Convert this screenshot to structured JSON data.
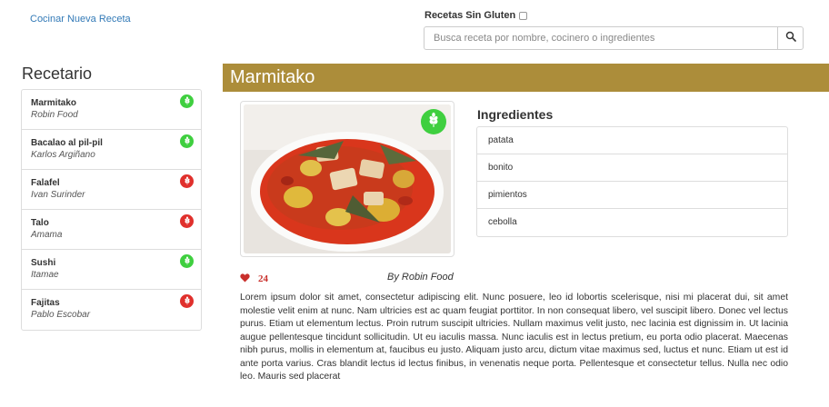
{
  "header": {
    "new_recipe_link": "Cocinar Nueva Receta",
    "gluten_filter_label": "Recetas Sin Gluten",
    "search_placeholder": "Busca receta por nombre, cocinero o ingredientes"
  },
  "sidebar": {
    "title": "Recetario",
    "items": [
      {
        "name": "Marmitako",
        "cook": "Robin Food",
        "gluten_free": true
      },
      {
        "name": "Bacalao al pil-pil",
        "cook": "Karlos Argiñano",
        "gluten_free": true
      },
      {
        "name": "Falafel",
        "cook": "Ivan Surinder",
        "gluten_free": false
      },
      {
        "name": "Talo",
        "cook": "Amama",
        "gluten_free": false
      },
      {
        "name": "Sushi",
        "cook": "Itamae",
        "gluten_free": true
      },
      {
        "name": "Fajitas",
        "cook": "Pablo Escobar",
        "gluten_free": false
      }
    ]
  },
  "recipe": {
    "title": "Marmitako",
    "ingredients_title": "Ingredientes",
    "ingredients": [
      "patata",
      "bonito",
      "pimientos",
      "cebolla"
    ],
    "likes": "24",
    "author": "By Robin Food",
    "description": "Lorem ipsum dolor sit amet, consectetur adipiscing elit. Nunc posuere, leo id lobortis scelerisque, nisi mi placerat dui, sit amet molestie velit enim at nunc. Nam ultricies est ac quam feugiat porttitor. In non consequat libero, vel suscipit libero. Donec vel lectus purus. Etiam ut elementum lectus. Proin rutrum suscipit ultricies. Nullam maximus velit justo, nec lacinia est dignissim in. Ut lacinia augue pellentesque tincidunt sollicitudin. Ut eu iaculis massa. Nunc iaculis est in lectus pretium, eu porta odio placerat. Maecenas nibh purus, mollis in elementum at, faucibus eu justo. Aliquam justo arcu, dictum vitae maximus sed, luctus et nunc. Etiam ut est id ante porta varius. Cras blandit lectus id lectus finibus, in venenatis neque porta. Pellentesque et consectetur tellus. Nulla nec odio leo. Mauris sed placerat"
  },
  "icons": {
    "gluten_free_badge": "wheat-icon",
    "gluten_badge": "wheat-icon",
    "search": "search-icon",
    "like": "heart-icon"
  },
  "colors": {
    "gluten_free": "#3fcf3f",
    "gluten": "#e0302c",
    "header_bar": "#ac8d3a",
    "link": "#337ab7",
    "likes": "#c9302c"
  }
}
